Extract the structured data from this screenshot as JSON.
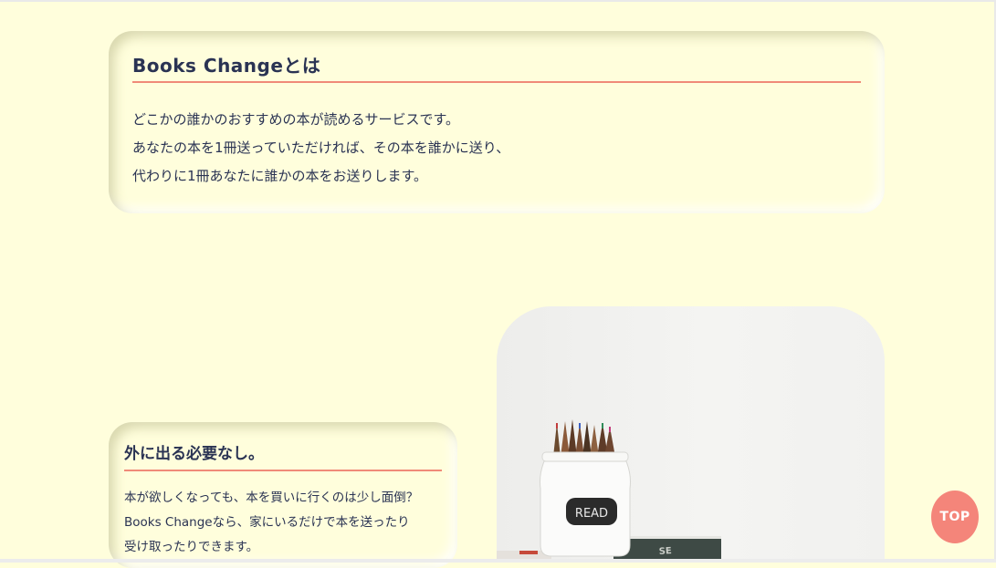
{
  "about": {
    "title": "Books Changeとは",
    "lines": [
      "どこかの誰かのおすすめの本が読めるサービスです。",
      "あなたの本を1冊送っていただければ、その本を誰かに送り、",
      "代わりに1冊あなたに誰かの本をお送りします。"
    ]
  },
  "feature": {
    "title": "外に出る必要なし。",
    "lines": [
      "本が欲しくなっても、本を買いに行くのは少し面倒？",
      "Books Changeなら、家にいるだけで本を送ったり",
      "受け取ったりできます。"
    ]
  },
  "photo": {
    "jar_label": "READ"
  },
  "top_button": {
    "label": "TOP"
  },
  "colors": {
    "background": "#FFFEDC",
    "accent": "#F08A78",
    "text": "#2A3353",
    "button": "#F4857A"
  }
}
